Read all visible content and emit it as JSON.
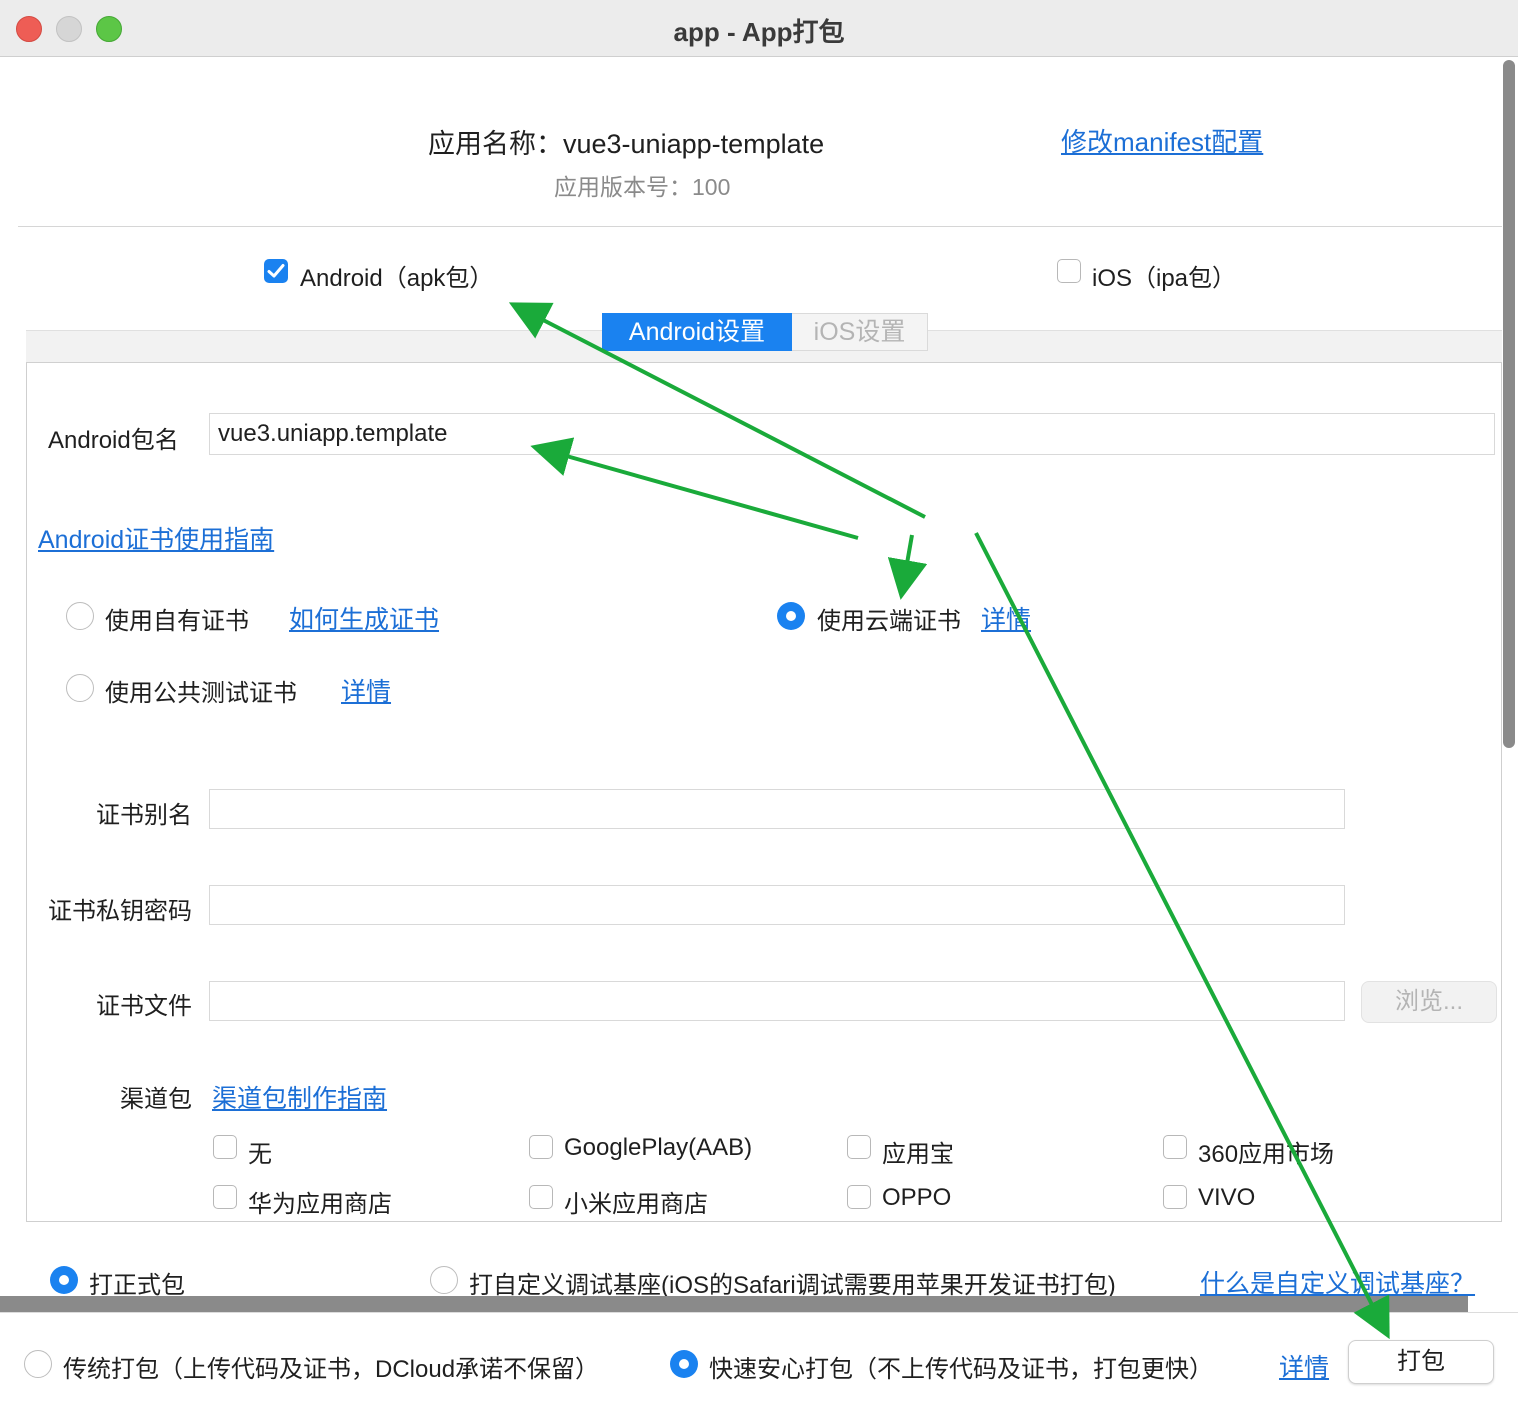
{
  "window": {
    "title": "app - App打包"
  },
  "header": {
    "app_name_line": "应用名称：vue3-uniapp-template",
    "version_line": "应用版本号：100",
    "manifest_link": "修改manifest配置"
  },
  "platforms": {
    "android": {
      "label": "Android（apk包）",
      "checked": true
    },
    "ios": {
      "label": "iOS（ipa包）",
      "checked": false
    }
  },
  "tabs": [
    {
      "label": "Android设置",
      "active": true
    },
    {
      "label": "iOS设置",
      "active": false
    }
  ],
  "android": {
    "package_label": "Android包名",
    "package_value": "vue3.uniapp.template",
    "cert_guide_link": "Android证书使用指南",
    "cert_options": {
      "own": {
        "label": "使用自有证书",
        "link": "如何生成证书",
        "selected": false
      },
      "cloud": {
        "label": "使用云端证书",
        "link": "详情",
        "selected": true
      },
      "public": {
        "label": "使用公共测试证书",
        "link": "详情",
        "selected": false
      }
    },
    "fields": {
      "alias": {
        "label": "证书别名",
        "value": ""
      },
      "password": {
        "label": "证书私钥密码",
        "value": ""
      },
      "file": {
        "label": "证书文件",
        "value": ""
      }
    },
    "browse_button": "浏览...",
    "channel": {
      "label": "渠道包",
      "guide_link": "渠道包制作指南",
      "options": [
        "无",
        "GooglePlay(AAB)",
        "应用宝",
        "360应用市场",
        "华为应用商店",
        "小米应用商店",
        "OPPO",
        "VIVO"
      ]
    }
  },
  "build_type": {
    "release": {
      "label": "打正式包",
      "selected": true
    },
    "custom": {
      "label": "打自定义调试基座(iOS的Safari调试需要用苹果开发证书打包)",
      "selected": false
    },
    "help_link": "什么是自定义调试基座？"
  },
  "pack_mode": {
    "traditional": {
      "label": "传统打包（上传代码及证书，DCloud承诺不保留）",
      "selected": false
    },
    "fast": {
      "label": "快速安心打包（不上传代码及证书，打包更快）",
      "selected": true
    },
    "details_link": "详情",
    "pack_button": "打包"
  },
  "colors": {
    "accent": "#1a82f0",
    "link": "#1c6fd6",
    "arrow": "#1aaa3a"
  }
}
